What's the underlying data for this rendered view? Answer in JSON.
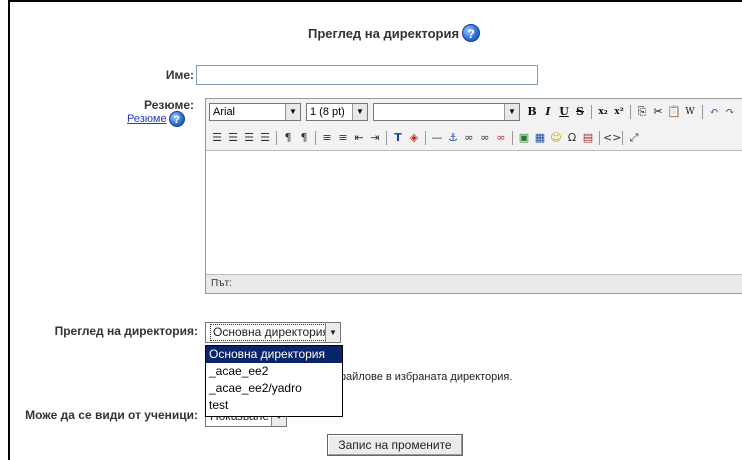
{
  "form": {
    "title": "Преглед на директория",
    "name_label": "Име:",
    "name_value": "",
    "summary_label": "Резюме:",
    "summary_help_link": "Резюме",
    "directory_label": "Преглед на директория:",
    "directory_selected": "Основна директория",
    "directory_options": [
      "Основна директория",
      "_acae_ee2",
      "_acae_ee2/yadro",
      "test"
    ],
    "directory_hint_visible": "файлове в избраната директория.",
    "visible_label": "Може да се види от ученици:",
    "visible_selected": "Показване",
    "submit_label": "Запис на промените"
  },
  "editor": {
    "font_family": "Arial",
    "font_size": "1 (8 pt)",
    "format_value": "",
    "path_label": "Път:",
    "toolbar_row1": [
      "B",
      "I",
      "U",
      "S",
      "x₂",
      "x²",
      "copy",
      "cut",
      "paste",
      "paste-word",
      "undo",
      "redo"
    ],
    "toolbar_row2": [
      "align-left",
      "align-center",
      "align-right",
      "justify",
      "ltr",
      "rtl",
      "ordered-list",
      "unordered-list",
      "outdent",
      "indent",
      "text-color",
      "bg-color",
      "hr",
      "anchor",
      "link",
      "unlink",
      "nolink",
      "image",
      "table",
      "smiley",
      "special-char",
      "insert-file",
      "html-source",
      "fullscreen"
    ]
  },
  "colors": {
    "help_blue": "#2f6fd6",
    "selected_bg": "#0a246a",
    "link_blue": "#1f3fbf"
  }
}
